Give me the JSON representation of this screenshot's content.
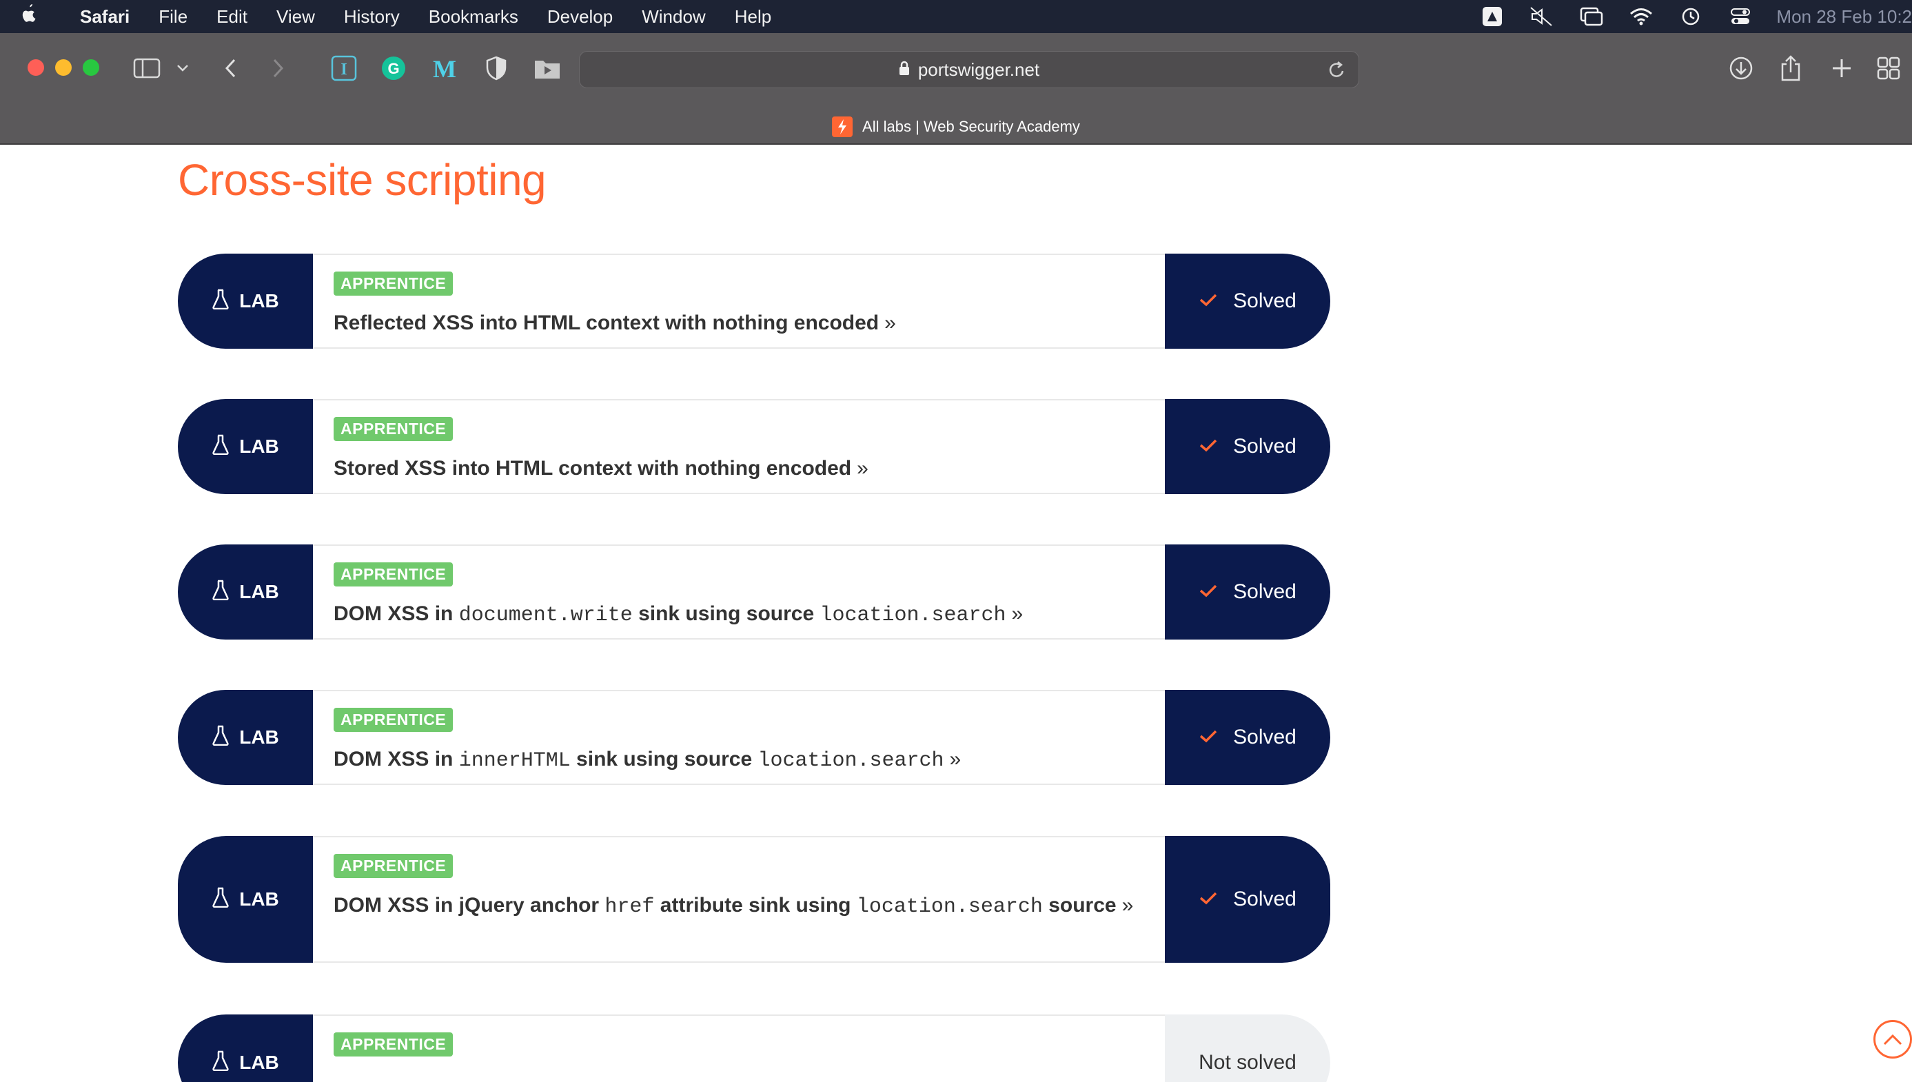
{
  "menubar": {
    "app": "Safari",
    "items": [
      "File",
      "Edit",
      "View",
      "History",
      "Bookmarks",
      "Develop",
      "Window",
      "Help"
    ],
    "clock": "Mon 28 Feb  10:2"
  },
  "browser": {
    "url": "portswigger.net",
    "tab_title": "All labs | Web Security Academy"
  },
  "page": {
    "title": "Cross-site scripting",
    "lab_label": "LAB",
    "level": "APPRENTICE",
    "chevron": "»",
    "labs": [
      {
        "title_parts": [
          "Reflected XSS into HTML context with nothing encoded"
        ],
        "status": "Solved"
      },
      {
        "title_parts": [
          "Stored XSS into HTML context with nothing encoded"
        ],
        "status": "Solved"
      },
      {
        "title_parts": [
          "DOM XSS in ",
          "document.write",
          " sink using source ",
          "location.search"
        ],
        "status": "Solved"
      },
      {
        "title_parts": [
          "DOM XSS in ",
          "innerHTML",
          " sink using source ",
          "location.search"
        ],
        "status": "Solved"
      },
      {
        "title_parts": [
          "DOM XSS in jQuery anchor ",
          "href",
          " attribute sink using ",
          "location.search",
          " source"
        ],
        "status": "Solved"
      },
      {
        "title_parts": [
          ""
        ],
        "status": "Not solved"
      }
    ]
  },
  "colors": {
    "accent": "#ff6633",
    "lab_navy": "#0b1a4d",
    "badge_green": "#70c96c"
  }
}
